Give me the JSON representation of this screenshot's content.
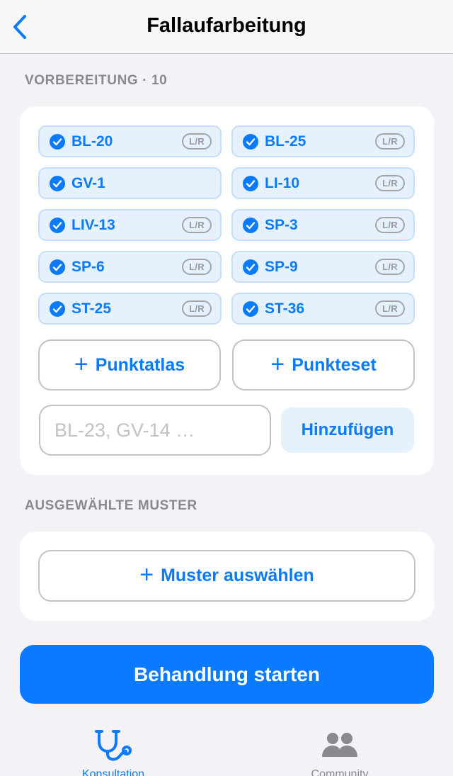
{
  "navbar": {
    "title": "Fallaufarbeitung",
    "back_icon": "chevron-left-icon"
  },
  "preparation": {
    "header": "VORBEREITUNG · 10",
    "points": [
      {
        "label": "BL-20",
        "side_badge": "L/R"
      },
      {
        "label": "BL-25",
        "side_badge": "L/R"
      },
      {
        "label": "GV-1",
        "side_badge": ""
      },
      {
        "label": "LI-10",
        "side_badge": "L/R"
      },
      {
        "label": "LIV-13",
        "side_badge": "L/R"
      },
      {
        "label": "SP-3",
        "side_badge": "L/R"
      },
      {
        "label": "SP-6",
        "side_badge": "L/R"
      },
      {
        "label": "SP-9",
        "side_badge": "L/R"
      },
      {
        "label": "ST-25",
        "side_badge": "L/R"
      },
      {
        "label": "ST-36",
        "side_badge": "L/R"
      }
    ],
    "point_atlas_label": "Punktatlas",
    "point_set_label": "Punkteset",
    "input_placeholder": "BL-23, GV-14 …",
    "input_value": "",
    "add_label": "Hinzufügen"
  },
  "patterns": {
    "header": "AUSGEWÄHLTE MUSTER",
    "select_label": "Muster auswählen"
  },
  "start_button_label": "Behandlung starten",
  "tabbar": {
    "tabs": [
      {
        "label": "Konsultation",
        "icon": "stethoscope-icon",
        "active": true
      },
      {
        "label": "Community",
        "icon": "people-icon",
        "active": false
      }
    ]
  },
  "colors": {
    "accent": "#0a7aff",
    "chip_bg": "#e5f1fd",
    "background": "#f2f2f7",
    "inactive": "#8a8a8e"
  }
}
